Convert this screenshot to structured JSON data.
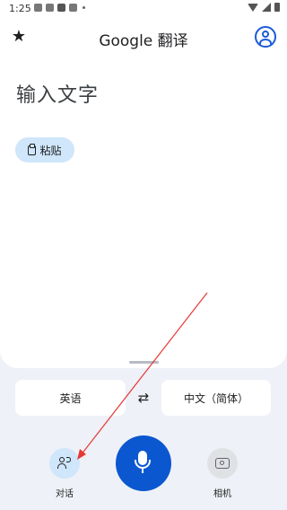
{
  "status_bar": {
    "time": "1:25"
  },
  "header": {
    "title": "Google 翻译",
    "favorites_icon": "star-icon",
    "account_icon": "account-circle-icon"
  },
  "input": {
    "placeholder": "输入文字"
  },
  "paste": {
    "label": "粘贴",
    "icon": "clipboard-icon"
  },
  "languages": {
    "source": "英语",
    "target": "中文（简体）",
    "swap_icon": "swap-arrows-icon"
  },
  "actions": {
    "conversation": {
      "label": "对话",
      "icon": "people-icon"
    },
    "voice": {
      "icon": "mic-icon"
    },
    "camera": {
      "label": "相机",
      "icon": "camera-icon"
    }
  },
  "colors": {
    "accent": "#0b57d0",
    "chip": "#cfe6fb",
    "annotation_arrow": "#e53935"
  }
}
